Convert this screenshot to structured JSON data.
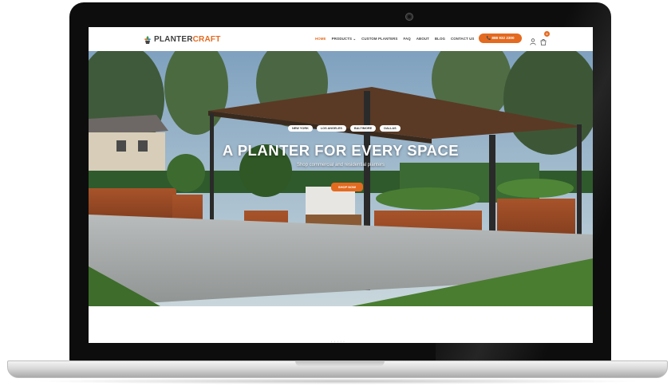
{
  "brand": {
    "logo_part1": "PLANTER",
    "logo_part2": "CRAFT",
    "accent_color": "#e46a1f"
  },
  "nav": {
    "items": [
      {
        "label": "HOME",
        "active": true
      },
      {
        "label": "PRODUCTS ⌄",
        "active": false
      },
      {
        "label": "CUSTOM PLANTERS",
        "active": false
      },
      {
        "label": "FAQ",
        "active": false
      },
      {
        "label": "ABOUT",
        "active": false
      },
      {
        "label": "BLOG",
        "active": false
      },
      {
        "label": "CONTACT US",
        "active": false
      }
    ],
    "phone": "📞 888 932 2300",
    "user_icon": "user-icon",
    "cart_icon": "cart-icon",
    "cart_count": "0"
  },
  "hero": {
    "cities": [
      "NEW YORK",
      "LOS ANGELES",
      "BALTIMORE",
      "DALLAS"
    ],
    "title": "A PLANTER FOR EVERY SPACE",
    "subtitle": "Shop commercial and residential planters",
    "cta": "SHOP NOW"
  },
  "footer": {
    "pager": "• • • • •"
  }
}
